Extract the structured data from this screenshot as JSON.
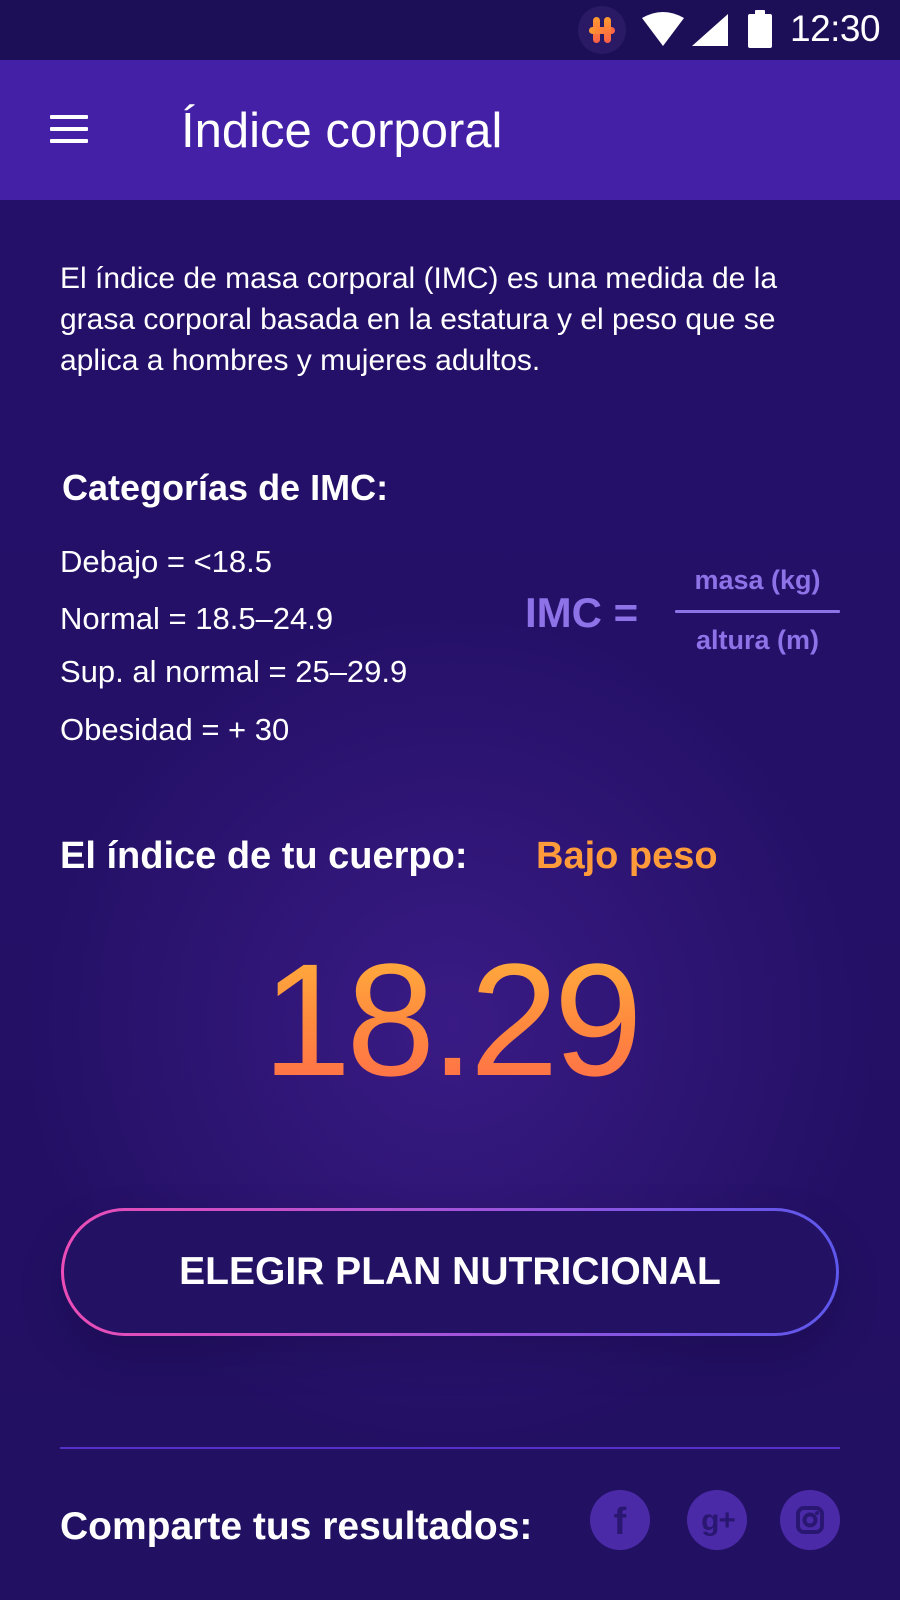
{
  "status_bar": {
    "app_icon": "hamburger-glyph-app-icon",
    "wifi_icon": "wifi-icon",
    "signal_icon": "signal-icon",
    "battery_icon": "battery-icon",
    "time": "12:30"
  },
  "app_bar": {
    "menu_icon": "menu-icon",
    "title": "Índice corporal"
  },
  "main": {
    "intro": "El índice de masa corporal (IMC) es una medida de la grasa corporal basada en la estatura y el peso que se aplica a hombres y mujeres adultos.",
    "categories_title": "Categorías de IMC:",
    "categories": [
      "Debajo = <18.5",
      "Normal = 18.5–24.9",
      "Sup. al normal = 25–29.9",
      "Obesidad = + 30"
    ],
    "formula": {
      "label": "IMC =",
      "numerator": "masa (kg)",
      "denominator": "altura (m)"
    },
    "body_index_label": "El índice de tu cuerpo:",
    "body_index_status": "Bajo peso",
    "bmi_value": "18.29",
    "plan_button_label": "ELEGIR PLAN NUTRICIONAL",
    "share_label": "Comparte tus resultados:",
    "social_icons": [
      "facebook-icon",
      "google-plus-icon",
      "instagram-icon"
    ]
  },
  "colors": {
    "background": "#221063",
    "app_bar": "#4320a5",
    "accent_orange": "#ff9b3b",
    "accent_purple": "#8d72e8",
    "button_gradient_start": "#ec4db6",
    "button_gradient_end": "#5d57ec"
  }
}
